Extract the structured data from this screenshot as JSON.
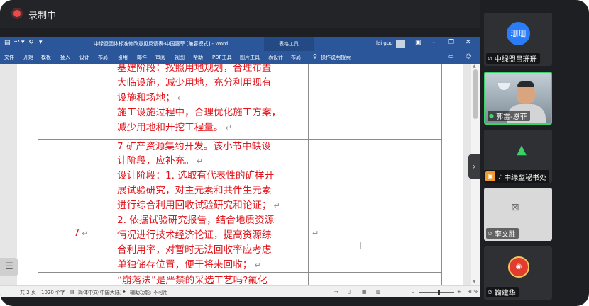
{
  "recording": {
    "label": "录制中"
  },
  "word": {
    "title": "中绿盟团体标准修改意见反馈表-中国惠菲 [兼容模式] - Word",
    "context_tab": "表格工具",
    "user": "lei guo",
    "ribbon_tabs": [
      "文件",
      "开始",
      "模板",
      "插入",
      "设计",
      "布局",
      "引用",
      "邮件",
      "审阅",
      "视图",
      "帮助",
      "PDF工具",
      "图片工具",
      "表设计",
      "布局"
    ],
    "tell_me": "操作说明搜索",
    "doc": {
      "lines": [
        "基建阶段：按照用地规划，合理布置",
        "大临设施，减少用地，充分利用现有",
        "设施和场地；",
        "施工设施过程中，合理优化施工方案，",
        "减少用地和开挖工程量。",
        "7 矿产资源集约开发。该小节中缺设",
        "计阶段，应补充。",
        "设计阶段：1. 选取有代表性的矿样开",
        "展试验研究，对主元素和共伴生元素",
        "进行综合利用回收试验研究和论证；",
        "2. 依据试验研究报告，结合地质资源",
        "情况进行技术经济论证，提高资源综",
        "合利用率，对暂时无法回收率应考虑",
        "单独储存位置，便于将来回收；",
        "“崩落法”是严禁的采选工艺吗?氟化"
      ],
      "row_number": "7",
      "para_mark": "↵"
    },
    "status": {
      "page": "共 2 页",
      "words": "1020 个字",
      "lang": "简体中文(中国大陆)",
      "assist": "辅助功能: 不可用",
      "zoom": "190%"
    }
  },
  "participants": [
    {
      "name": "中绿盟吕珊珊",
      "avatar_text": "珊珊"
    },
    {
      "name": "郭雷-恩菲"
    },
    {
      "name": "中绿盟秘书处"
    },
    {
      "name": "李文胜"
    },
    {
      "name": "鞠建华"
    }
  ]
}
